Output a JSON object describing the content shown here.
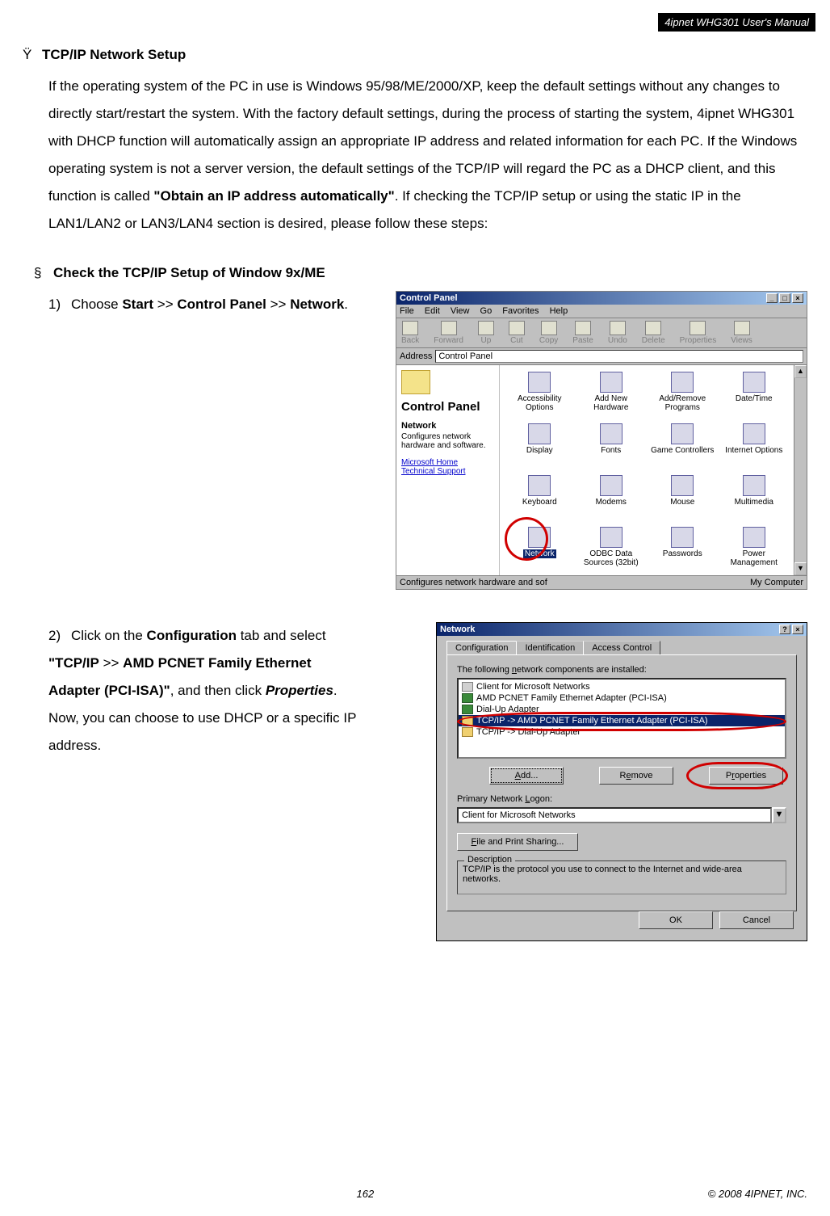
{
  "header": {
    "badge": "4ipnet WHG301 User's Manual"
  },
  "section": {
    "bullet": "Ÿ",
    "title": "TCP/IP Network Setup",
    "body_pre": "If the operating system of the PC in use is Windows 95/98/ME/2000/XP, keep the default settings without any changes to directly start/restart the system. With the factory default settings, during the process of starting the system, 4ipnet WHG301 with DHCP function will automatically assign an appropriate IP address and related information for each PC. If the Windows operating system is not a server version, the default settings of the TCP/IP will regard the PC as a DHCP client, and this function is called ",
    "body_bold": "\"Obtain an IP address automatically\"",
    "body_post": ". If checking the TCP/IP setup or using the static IP in the LAN1/LAN2 or LAN3/LAN4 section is desired, please follow these steps:"
  },
  "subsection": {
    "bullet": "§",
    "title": "Check the TCP/IP Setup of Window 9x/ME"
  },
  "step1": {
    "num": "1)",
    "t1": "Choose ",
    "b1": "Start",
    "t2": " >> ",
    "b2": "Control Panel",
    "t3": " >> ",
    "b3": "Network",
    "t4": "."
  },
  "step2": {
    "num": "2)",
    "t1": "Click on the ",
    "b1": "Configuration",
    "t2": " tab and select ",
    "b2": "\"TCP/IP",
    "t3": " >> ",
    "b3": "AMD PCNET Family Ethernet Adapter (PCI-ISA)\"",
    "t4": ", and then click ",
    "i1": "Properties",
    "t5": ". Now, you can choose to use DHCP or a specific IP address."
  },
  "cp": {
    "title": "Control Panel",
    "menus": [
      "File",
      "Edit",
      "View",
      "Go",
      "Favorites",
      "Help"
    ],
    "toolbar": [
      "Back",
      "Forward",
      "Up",
      "Cut",
      "Copy",
      "Paste",
      "Undo",
      "Delete",
      "Properties",
      "Views"
    ],
    "addr_label": "Address",
    "addr_value": "Control Panel",
    "side_title": "Control Panel",
    "side_sub": "Network",
    "side_text": "Configures network hardware and software.",
    "side_link1": "Microsoft Home",
    "side_link2": "Technical Support",
    "icons": [
      "Accessibility Options",
      "Add New Hardware",
      "Add/Remove Programs",
      "Date/Time",
      "Display",
      "Fonts",
      "Game Controllers",
      "Internet Options",
      "Keyboard",
      "Modems",
      "Mouse",
      "Multimedia",
      "Network",
      "ODBC Data Sources (32bit)",
      "Passwords",
      "Power Management"
    ],
    "status_left": "Configures network hardware and sof",
    "status_right": "My Computer"
  },
  "net": {
    "title": "Network",
    "tabs": [
      "Configuration",
      "Identification",
      "Access Control"
    ],
    "components_label": "The following network components are installed:",
    "items": [
      "Client for Microsoft Networks",
      "AMD PCNET Family Ethernet Adapter (PCI-ISA)",
      "Dial-Up Adapter",
      "TCP/IP -> AMD PCNET Family Ethernet Adapter (PCI-ISA)",
      "TCP/IP -> Dial-Up Adapter"
    ],
    "btn_add": "Add...",
    "btn_remove": "Remove",
    "btn_properties": "Properties",
    "logon_label": "Primary Network Logon:",
    "logon_value": "Client for Microsoft Networks",
    "fps": "File and Print Sharing...",
    "desc_legend": "Description",
    "desc_text": "TCP/IP is the protocol you use to connect to the Internet and wide-area networks.",
    "ok": "OK",
    "cancel": "Cancel"
  },
  "footer": {
    "page": "162",
    "copyright": "© 2008 4IPNET, INC."
  }
}
